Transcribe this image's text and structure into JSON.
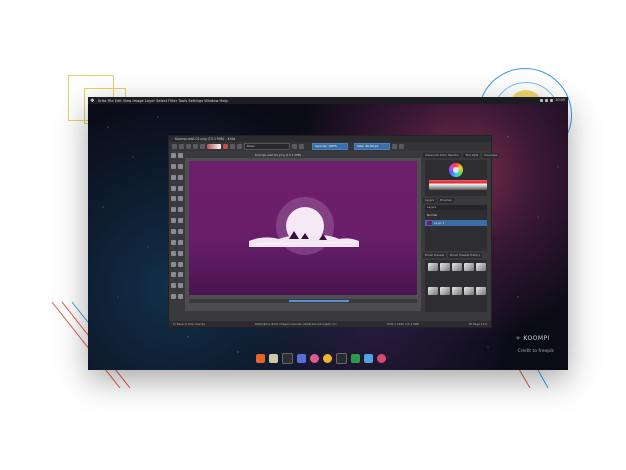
{
  "desktop": {
    "menu": "Krita   File   Edit   View   Image   Layer   Select   Filter   Tools   Settings   Window   Help",
    "clock": "10:05"
  },
  "krita": {
    "window_title": "Koompi-wall-01.png (13.1 MiB) – Krita",
    "document_tab": "Koompi-wall-01.png (13.1 MiB)",
    "brush_field": "Basic",
    "opacity_field": "Opacity: 100%",
    "size_field": "Size: 40.00 px",
    "status_left": "b) Basic-5 Size Opacity",
    "status_center": "RGB/Alpha (8-bit integer/channel) sRGB-elle-V2-srgbtrc.icc",
    "status_right": "7930 x 2480 (13.1 MiB)",
    "zoom": "Fit Page 11%",
    "docker_tabs": [
      "Advanced Color Selector",
      "Tool Opts",
      "Overview"
    ],
    "selector_tabs": [
      "Layers",
      "Brushes"
    ],
    "layers_header": "Layers",
    "blend_mode": "Normal",
    "layer_name": "Layer 1",
    "presets_tabs": [
      "Brush Presets",
      "Brush Presets History"
    ]
  },
  "branding": {
    "koompi": "KOOMPI",
    "credit": "Credit to freepik"
  },
  "colors": {
    "accent_blue": "#3a6ea5",
    "canvas_purple": "#6d1f6b",
    "deco_yellow": "#e3d36a"
  }
}
